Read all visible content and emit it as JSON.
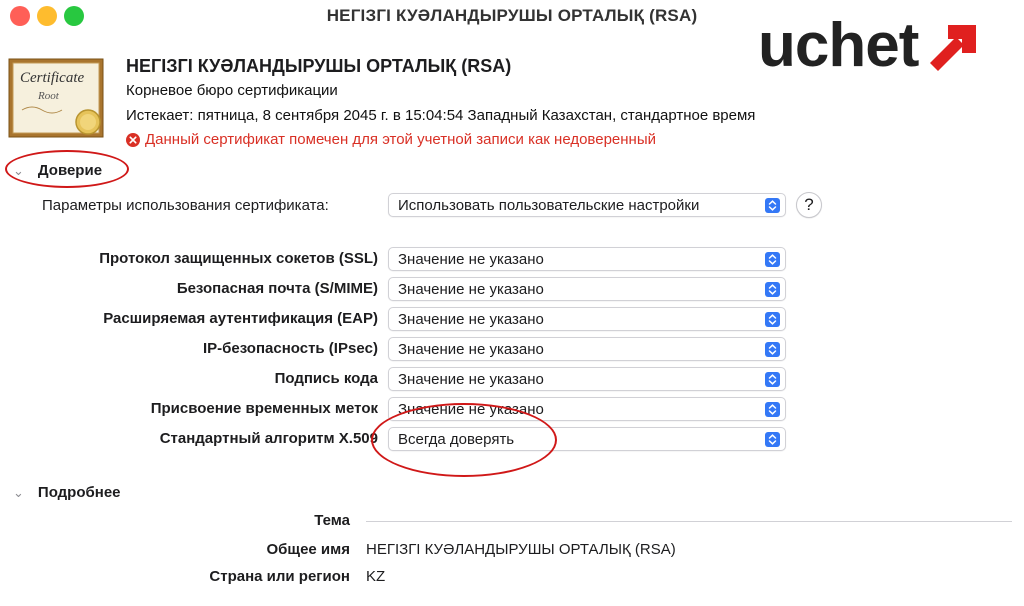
{
  "window": {
    "title": "НЕГІЗГІ КУӘЛАНДЫРУШЫ ОРТАЛЫҚ (RSA)"
  },
  "traffic_lights": {
    "close_color": "#ff5f57",
    "minimize_color": "#febc2e",
    "zoom_color": "#28c840"
  },
  "watermark": {
    "text": "uchet",
    "accent_color": "#e0201f"
  },
  "certificate": {
    "image_text": "Certificate",
    "image_subtext": "Root",
    "name": "НЕГІЗГІ КУӘЛАНДЫРУШЫ ОРТАЛЫҚ (RSA)",
    "kind": "Корневое бюро сертификации",
    "expires": "Истекает: пятница, 8 сентября 2045 г. в 15:04:54 Западный Казахстан, стандартное время",
    "warning": "Данный сертификат помечен для этой учетной записи как недоверенный",
    "warning_color": "#d93025"
  },
  "trust": {
    "section_label": "Доверие",
    "usage_label": "Параметры использования сертификата:",
    "usage_value": "Использовать пользовательские настройки",
    "help_label": "?",
    "rows": [
      {
        "label": "Протокол защищенных сокетов (SSL)",
        "value": "Значение не указано"
      },
      {
        "label": "Безопасная почта (S/MIME)",
        "value": "Значение не указано"
      },
      {
        "label": "Расширяемая аутентификация (EAP)",
        "value": "Значение не указано"
      },
      {
        "label": "IP-безопасность (IPsec)",
        "value": "Значение не указано"
      },
      {
        "label": "Подпись кода",
        "value": "Значение не указано"
      },
      {
        "label": "Присвоение временных меток",
        "value": "Значение не указано"
      },
      {
        "label": "Стандартный алгоритм X.509",
        "value": "Всегда доверять"
      }
    ]
  },
  "details": {
    "section_label": "Подробнее",
    "subject_label": "Тема",
    "fields": [
      {
        "label": "Общее имя",
        "value": "НЕГІЗГІ КУӘЛАНДЫРУШЫ ОРТАЛЫҚ (RSA)"
      },
      {
        "label": "Страна или регион",
        "value": "KZ"
      }
    ]
  },
  "annotation_color": "#d01818",
  "accent_color": "#3478f6"
}
